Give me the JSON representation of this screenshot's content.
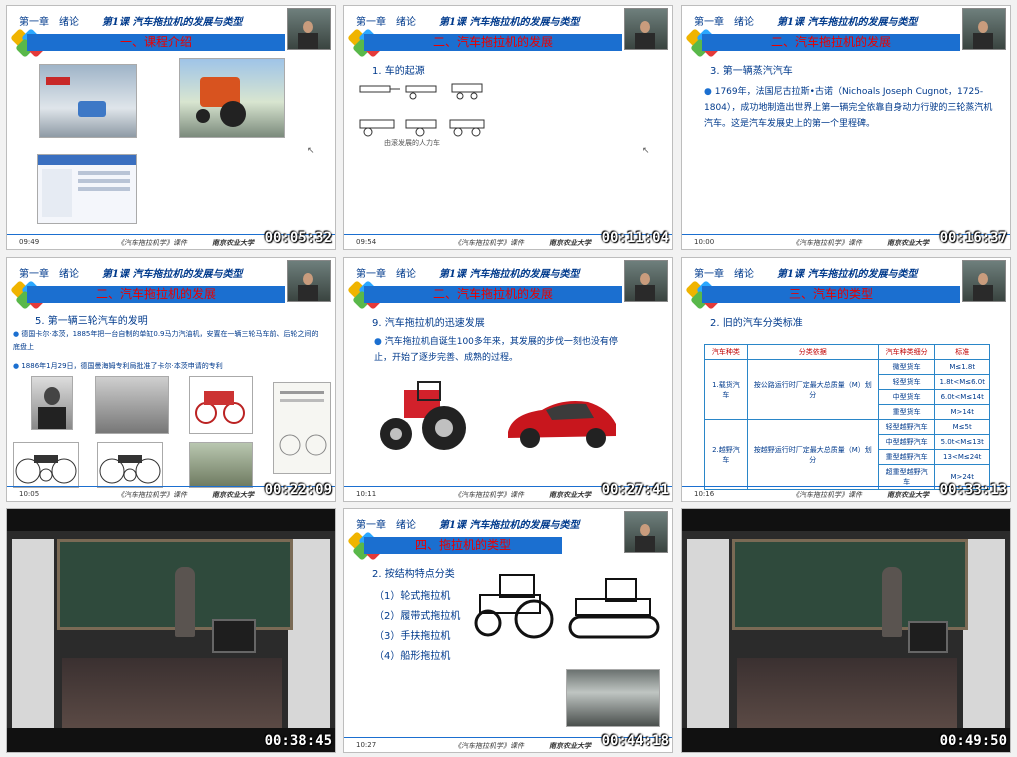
{
  "header": {
    "chapter": "第一章",
    "chapter_name": "绪论",
    "lesson": "第1课 汽车拖拉机的发展与类型"
  },
  "footer": {
    "course": "《汽车拖拉机学》课件",
    "university": "南京农业大学"
  },
  "thumbs": [
    {
      "id": "t1",
      "timestamp": "00:05:32",
      "clock": "09:49",
      "section": "一、课程介绍"
    },
    {
      "id": "t2",
      "timestamp": "00:11:04",
      "clock": "09:54",
      "section": "二、汽车拖拉机的发展",
      "subtitle": "1. 车的起源",
      "caption": "由滚发展的人力车"
    },
    {
      "id": "t3",
      "timestamp": "00:16:37",
      "clock": "10:00",
      "section": "二、汽车拖拉机的发展",
      "subtitle": "3. 第一辆蒸汽汽车",
      "text": "1769年，法国尼古拉斯•古诺（Nichoals Joseph Cugnot，1725-1804），成功地制造出世界上第一辆完全依靠自身动力行驶的三轮蒸汽机汽车。这是汽车发展史上的第一个里程碑。"
    },
    {
      "id": "t4",
      "timestamp": "00:22:09",
      "clock": "10:05",
      "section": "二、汽车拖拉机的发展",
      "subtitle": "5. 第一辆三轮汽车的发明",
      "bullet1": "德国卡尔·本茨，1885年把一台自制的单缸0.9马力汽油机，安置在一辆三轮马车前、后轮之间的底盘上",
      "bullet2": "1886年1月29日，德国曼海姆专利局批准了卡尔·本茨申请的专利"
    },
    {
      "id": "t5",
      "timestamp": "00:27:41",
      "clock": "10:11",
      "section": "二、汽车拖拉机的发展",
      "subtitle": "9. 汽车拖拉机的迅速发展",
      "text": "汽车拖拉机自诞生100多年来，其发展的步伐一刻也没有停止，开始了逐步完善、成熟的过程。"
    },
    {
      "id": "t6",
      "timestamp": "00:33:13",
      "clock": "10:16",
      "section": "三、汽车的类型",
      "subtitle": "2. 旧的汽车分类标准",
      "table_headers": [
        "汽车种类",
        "分类依据",
        "汽车种类细分",
        "标准"
      ],
      "rows_a_label": "1.载货汽车",
      "rows_a_basis": "按公路运行时厂定最大总质量（M）划分",
      "rows_a": [
        [
          "微型货车",
          "M≤1.8t"
        ],
        [
          "轻型货车",
          "1.8t<M≤6.0t"
        ],
        [
          "中型货车",
          "6.0t<M≤14t"
        ],
        [
          "重型货车",
          "M>14t"
        ]
      ],
      "rows_b_label": "2.越野汽车",
      "rows_b_basis": "按越野运行时厂定最大总质量（M）划分",
      "rows_b": [
        [
          "轻型越野汽车",
          "M≤5t"
        ],
        [
          "中型越野汽车",
          "5.0t<M≤13t"
        ],
        [
          "重型越野汽车",
          "13<M≤24t"
        ],
        [
          "超重型越野汽车",
          "M>24t"
        ]
      ]
    },
    {
      "id": "t7",
      "timestamp": "00:38:45"
    },
    {
      "id": "t8",
      "timestamp": "00:44:18",
      "clock": "10:27",
      "section": "四、拖拉机的类型",
      "subtitle": "2. 按结构特点分类",
      "items": [
        "（1）轮式拖拉机",
        "（2）履带式拖拉机",
        "（3）手扶拖拉机",
        "（4）船形拖拉机"
      ]
    },
    {
      "id": "t9",
      "timestamp": "00:49:50"
    }
  ]
}
